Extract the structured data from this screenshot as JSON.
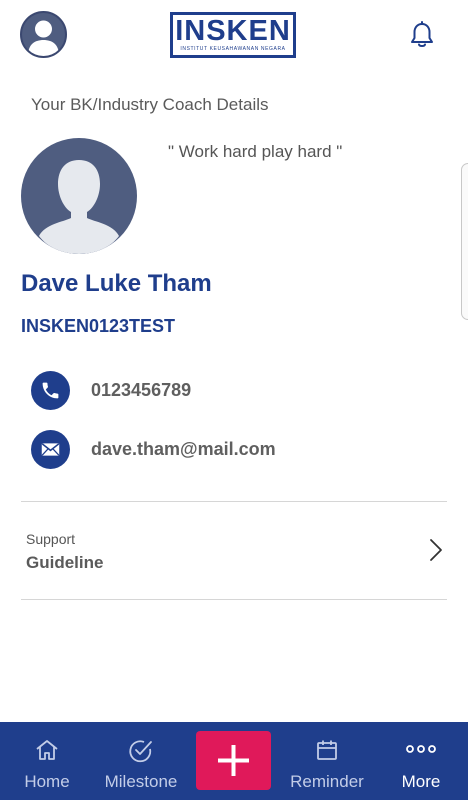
{
  "header": {
    "logo_text": "INSKEN",
    "logo_subtitle": "INSTITUT KEUSAHAWANAN NEGARA"
  },
  "page": {
    "section_title": "Your BK/Industry Coach Details",
    "quote": "\" Work hard play hard \""
  },
  "coach": {
    "name": "Dave Luke Tham",
    "code": "INSKEN0123TEST",
    "phone": "0123456789",
    "email": "dave.tham@mail.com"
  },
  "support": {
    "label": "Support",
    "value": "Guideline"
  },
  "bottom_nav": {
    "items": [
      {
        "label": "Home",
        "icon": "home-icon"
      },
      {
        "label": "Milestone",
        "icon": "check-circle-icon"
      },
      {
        "label": "Reminder",
        "icon": "calendar-icon"
      },
      {
        "label": "More",
        "icon": "more-dots-icon"
      }
    ],
    "active": "More"
  },
  "colors": {
    "brand_blue": "#1f3e8c",
    "add_button": "#e0195a",
    "avatar_bg": "#4f5d80"
  }
}
